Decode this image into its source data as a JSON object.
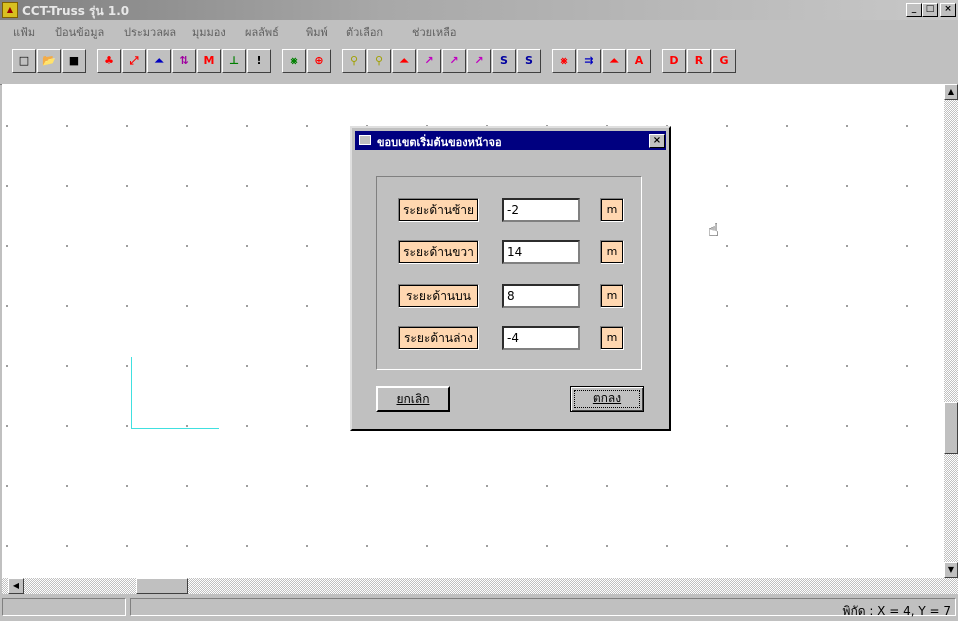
{
  "window": {
    "title": "CCT-Truss  รุ่น 1.0",
    "controls": [
      "_",
      "□",
      "×"
    ]
  },
  "menu": [
    "แฟ้ม",
    "ป้อนข้อมูล",
    "ประมวลผล",
    "มุมมอง",
    "ผลลัพธ์",
    "พิมพ์",
    "ตัวเลือก",
    "ช่วยเหลือ"
  ],
  "toolbar": {
    "buttons": [
      {
        "name": "new-icon",
        "glyph": "□",
        "color": "#000000"
      },
      {
        "name": "open-icon",
        "glyph": "📂",
        "color": "#c8a000"
      },
      {
        "name": "save-icon",
        "glyph": "■",
        "color": "#000000"
      },
      {
        "name": "node-icon",
        "glyph": "♣",
        "color": "#ff0000"
      },
      {
        "name": "member-icon",
        "glyph": "⤢",
        "color": "#ff0000"
      },
      {
        "name": "support-icon",
        "glyph": "⏶",
        "color": "#0000c0"
      },
      {
        "name": "load-icon",
        "glyph": "⇅",
        "color": "#a000a0"
      },
      {
        "name": "moment-icon",
        "glyph": "M",
        "color": "#ff0000"
      },
      {
        "name": "section-icon",
        "glyph": "⊥",
        "color": "#008000"
      },
      {
        "name": "run-icon",
        "glyph": "!",
        "color": "#000000"
      },
      {
        "name": "truss-icon",
        "glyph": "⨳",
        "color": "#008000"
      },
      {
        "name": "center-icon",
        "glyph": "⊕",
        "color": "#ff0000"
      },
      {
        "name": "zoom-in-icon",
        "glyph": "⚲",
        "color": "#a0a000"
      },
      {
        "name": "zoom-out-icon",
        "glyph": "⚲",
        "color": "#a0a000"
      },
      {
        "name": "deformed-icon",
        "glyph": "⏶",
        "color": "#ff0000"
      },
      {
        "name": "graph-1-icon",
        "glyph": "↗",
        "color": "#c000c0"
      },
      {
        "name": "graph-2-icon",
        "glyph": "↗",
        "color": "#c000c0"
      },
      {
        "name": "graph-3-icon",
        "glyph": "↗",
        "color": "#c000c0"
      },
      {
        "name": "scale-1-icon",
        "glyph": "S",
        "color": "#0000a0"
      },
      {
        "name": "scale-2-icon",
        "glyph": "S",
        "color": "#0000a0"
      },
      {
        "name": "frame-icon",
        "glyph": "⨳",
        "color": "#ff0000"
      },
      {
        "name": "force-icon",
        "glyph": "⇉",
        "color": "#0000c0"
      },
      {
        "name": "reaction-icon",
        "glyph": "⏶",
        "color": "#ff0000"
      },
      {
        "name": "area-icon",
        "glyph": "A",
        "color": "#ff0000"
      },
      {
        "name": "report-d-icon",
        "glyph": "D",
        "color": "#ff0000"
      },
      {
        "name": "report-r-icon",
        "glyph": "R",
        "color": "#ff0000"
      },
      {
        "name": "report-g-icon",
        "glyph": "G",
        "color": "#ff0000"
      }
    ]
  },
  "dialog": {
    "title": "ขอบเขตเริ่มต้นของหน้าจอ",
    "close": "×",
    "fields": [
      {
        "label": "ระยะด้านซ้าย",
        "value": "-2",
        "unit": "m"
      },
      {
        "label": "ระยะด้านขวา",
        "value": "14",
        "unit": "m"
      },
      {
        "label": "ระยะด้านบน",
        "value": "8",
        "unit": "m"
      },
      {
        "label": "ระยะด้านล่าง",
        "value": "-4",
        "unit": "m"
      }
    ],
    "cancel_label": "ยกเลิก",
    "ok_label": "ตกลง"
  },
  "status": {
    "coords": "พิกัด : X = 4, Y = 7"
  }
}
